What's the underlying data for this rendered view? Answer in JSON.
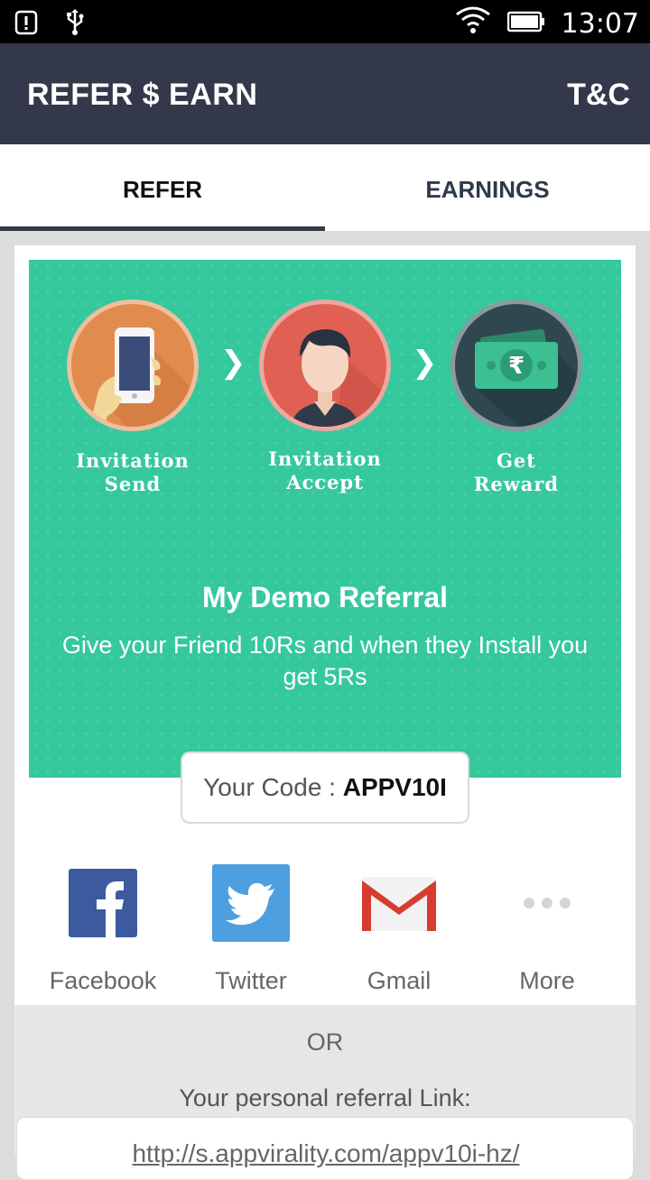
{
  "status_bar": {
    "time": "13:07",
    "icons": [
      "notification-icon",
      "usb-icon",
      "wifi-icon",
      "battery-icon"
    ]
  },
  "app_bar": {
    "title": "REFER $ EARN",
    "action": "T&C"
  },
  "tabs": [
    {
      "label": "REFER",
      "selected": true
    },
    {
      "label": "EARNINGS",
      "selected": false
    }
  ],
  "steps": [
    {
      "label_line1": "Invitation",
      "label_line2": "Send",
      "icon": "phone-hand-icon"
    },
    {
      "label_line1": "Invitation",
      "label_line2": "Accept",
      "icon": "person-avatar-icon"
    },
    {
      "label_line1": "Get",
      "label_line2": "Reward",
      "icon": "rupee-money-icon"
    }
  ],
  "step_arrow": "❯",
  "banner": {
    "title": "My Demo Referral",
    "description": "Give your Friend 10Rs and when they Install you get 5Rs",
    "color": "#35c89c"
  },
  "code": {
    "label": "Your Code : ",
    "value": "APPV10I"
  },
  "share_options": [
    {
      "label": "Facebook",
      "icon": "facebook-icon"
    },
    {
      "label": "Twitter",
      "icon": "twitter-icon"
    },
    {
      "label": "Gmail",
      "icon": "gmail-icon"
    },
    {
      "label": "More",
      "icon": "more-dots-icon"
    }
  ],
  "or_text": "OR",
  "link_label": "Your personal referral Link:",
  "link_url": "http://s.appvirality.com/appv10i-hz/",
  "colors": {
    "app_bar": "#33394a",
    "accent_green": "#35c89c"
  }
}
